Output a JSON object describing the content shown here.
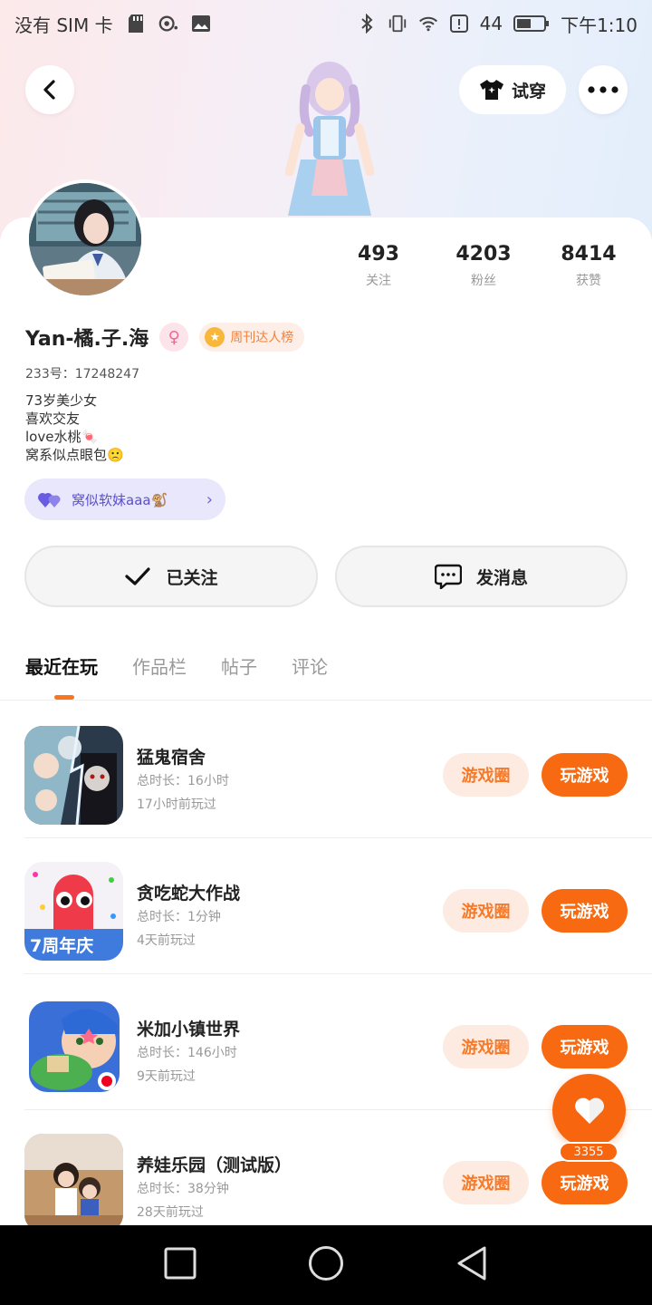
{
  "status_bar": {
    "carrier": "没有 SIM 卡",
    "battery_level": "44",
    "time": "下午1:10"
  },
  "header": {
    "tryon_label": "试穿"
  },
  "profile": {
    "name": "Yan-橘.子.海",
    "gender_symbol": "♀",
    "weekly_badge": "周刊达人榜",
    "uid": "233号：17248247",
    "bio_lines": [
      "73岁美少女",
      "喜欢交友",
      "love水桃🍬",
      "窝系似点眼包🙁"
    ],
    "cp_label": "窝似软妹aaa🐒",
    "stats": [
      {
        "value": "493",
        "label": "关注"
      },
      {
        "value": "4203",
        "label": "粉丝"
      },
      {
        "value": "8414",
        "label": "获赞"
      }
    ]
  },
  "actions": {
    "follow_label": "已关注",
    "message_label": "发消息"
  },
  "tabs": [
    "最近在玩",
    "作品栏",
    "帖子",
    "评论"
  ],
  "games": [
    {
      "name": "猛鬼宿舍",
      "total": "总时长：16小时",
      "last": "17小时前玩过",
      "circle": "游戏圈",
      "play": "玩游戏"
    },
    {
      "name": "贪吃蛇大作战",
      "total": "总时长：1分钟",
      "last": "4天前玩过",
      "circle": "游戏圈",
      "play": "玩游戏",
      "icon_text": "7周年庆"
    },
    {
      "name": "米加小镇世界",
      "total": "总时长：146小时",
      "last": "9天前玩过",
      "circle": "游戏圈",
      "play": "玩游戏"
    },
    {
      "name": "养娃乐园（测试版）",
      "total": "总时长：38分钟",
      "last": "28天前玩过",
      "circle": "游戏圈",
      "play": "玩游戏"
    }
  ],
  "fab": {
    "count": "3355"
  },
  "colors": {
    "accent": "#f7650f",
    "cp_purple": "#5b4fd0",
    "hero_pink": "#fce9ea",
    "hero_blue": "#e3eefb"
  }
}
